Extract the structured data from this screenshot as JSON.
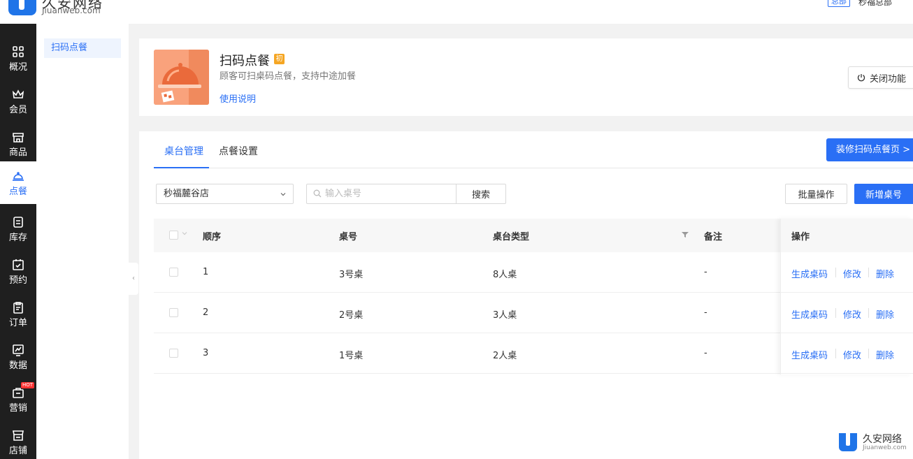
{
  "header": {
    "logo_cn": "久安网络",
    "logo_en": "Jiuanweb.com",
    "org_badge": "总部",
    "org_name": "秒福总部"
  },
  "sidebar": {
    "items": [
      {
        "label": "概况",
        "icon": "grid-icon"
      },
      {
        "label": "会员",
        "icon": "crown-icon"
      },
      {
        "label": "商品",
        "icon": "store-icon"
      },
      {
        "label": "点餐",
        "icon": "cloche-icon",
        "active": true
      },
      {
        "label": "库存",
        "icon": "inventory-icon"
      },
      {
        "label": "预约",
        "icon": "calendar-check-icon"
      },
      {
        "label": "订单",
        "icon": "clipboard-icon"
      },
      {
        "label": "数据",
        "icon": "chart-icon"
      },
      {
        "label": "营销",
        "icon": "megaphone-icon",
        "badge": "HOT"
      },
      {
        "label": "店铺",
        "icon": "shop-icon"
      }
    ]
  },
  "subnav": {
    "items": [
      {
        "label": "扫码点餐",
        "active": true
      }
    ]
  },
  "feature": {
    "title": "扫码点餐",
    "tag": "初",
    "description": "顾客可扫桌码点餐，支持中途加餐",
    "help_link": "使用说明",
    "close_button": "关闭功能"
  },
  "tabs": [
    {
      "label": "桌台管理",
      "active": true
    },
    {
      "label": "点餐设置",
      "active": false
    }
  ],
  "decorate_button": "装修扫码点餐页 >",
  "filters": {
    "store_selected": "秒福麓谷店",
    "search_placeholder": "输入桌号",
    "search_button": "搜索",
    "batch_button": "批量操作",
    "add_button": "新增桌号"
  },
  "table": {
    "headers": {
      "order": "顺序",
      "table_no": "桌号",
      "table_type": "桌台类型",
      "remark": "备注",
      "actions": "操作"
    },
    "rows": [
      {
        "order": "1",
        "table_no": "3号桌",
        "table_type": "8人桌",
        "remark": "-"
      },
      {
        "order": "2",
        "table_no": "2号桌",
        "table_type": "3人桌",
        "remark": "-"
      },
      {
        "order": "3",
        "table_no": "1号桌",
        "table_type": "2人桌",
        "remark": "-"
      }
    ],
    "actions": {
      "generate": "生成桌码",
      "edit": "修改",
      "delete": "删除"
    }
  },
  "watermark": {
    "cn": "久安网络",
    "en": "Jiuanweb.com"
  },
  "colors": {
    "primary": "#2a6ff5",
    "sidebar_bg": "#1f1f1f",
    "thumb_bg": "#f9a27c",
    "tag_bg": "#f5a623"
  }
}
